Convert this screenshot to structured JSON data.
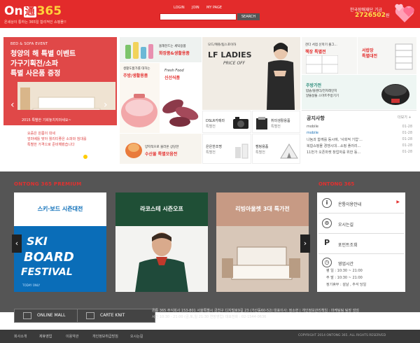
{
  "header": {
    "logo_on": "On",
    "logo_tong": "通",
    "logo_num": "365",
    "slogan": "온세상이 통하는 365일 합리적인 쇼핑몰!!",
    "links": [
      "LOGIN",
      "JOIN",
      "MY PAGE"
    ],
    "search_button": "SEARCH",
    "fund_label": "한국장애재단 기금",
    "fund_count": "2726502",
    "fund_unit": "원"
  },
  "slider": {
    "tag": "BED & SOFA EVENT",
    "title_lines": [
      "청양의 해 특별 이벤트",
      "가구기획전/소파",
      "특별 사은품 증정"
    ],
    "caption": "2015 특별한 기회놓치지마세요~",
    "desc": [
      "요즘은 원룸이 대세",
      "엄마베틀 맞아 퀄리티좋은 소파와 침대를",
      "특별한 가격으로 준비해봤습니다"
    ],
    "prev": "‹",
    "next": "›",
    "dots": 4
  },
  "promo": {
    "top_left": {
      "t1": "올해찬드는 세탁용품",
      "t2": "화장품&생활용품"
    },
    "mid_left": {
      "t1": "생활도품가를 대하는",
      "t2": "주방/생활용품"
    },
    "fresh": {
      "t1": "Fresh Food",
      "t2": "신선식품"
    },
    "lf": {
      "t0": "모드/캐쥬/팀스포이하",
      "t1": "LF LADIES",
      "t2": "PRICE OFF"
    },
    "book": {
      "t1": "찬다 서점 신학기 출그...",
      "t2": "책장 특별전"
    },
    "desk": {
      "t1": "서랍장",
      "t2": "특별대전"
    },
    "kitchen": {
      "t1": "주방가전",
      "t2": "밥솥/블렌더/전자레인지",
      "t3": "알뜰살뜰 스마트주방기기"
    },
    "dslr": {
      "t1": "DSLR카메라",
      "t2": "특별전"
    },
    "hobby": {
      "t1": "취미생활용품",
      "t2": "특별전"
    },
    "heat": {
      "t1": "은은한조명",
      "t2": "특별전"
    },
    "camp": {
      "t1": "캠핑용품",
      "t2": "특별전"
    },
    "soup": {
      "t1": "양지적으로 물러온 상당한",
      "t2": "수산물 특별모음전"
    }
  },
  "notice": {
    "title": "공지사항",
    "more": "더보기 +",
    "items": [
      {
        "text": "mobile",
        "date": "01-28"
      },
      {
        "text": "mobile",
        "date": "01-28"
      },
      {
        "text": "나눔과 함께를 동시에, '사회적 기업'...",
        "date": "01-28"
      },
      {
        "text": "복합쇼핑몰 경쟁시대…쇼핑 플러리...",
        "date": "01-28"
      },
      {
        "text": "11번가 오픈마켓 창업자를 위한 동...",
        "date": "01-28"
      }
    ]
  },
  "premium": {
    "title": "ONTONG 365 PREMIUM",
    "cards": [
      {
        "label": "스키·보드 시즌대전",
        "art1": "SKI",
        "art2": "BOARD",
        "art3": "FESTIVAL",
        "art_small": "TODAY ONLY",
        "color": "#0a6db8"
      },
      {
        "label": "라코스테 시즌오프",
        "color": "#1f4f36"
      },
      {
        "label": "리빙아울렛 3대 특가전",
        "color": "#c79a84"
      }
    ],
    "prev": "‹",
    "next": "›"
  },
  "o365": {
    "title": "ONTONG 365",
    "menu": [
      {
        "icon": "i",
        "label": "온통이용안내"
      },
      {
        "icon": "⊙",
        "label": "오시는길"
      },
      {
        "icon": "P",
        "label": "포인트조회"
      },
      {
        "icon": "◷",
        "label": "영업시간"
      }
    ],
    "hours": [
      {
        "day": "평 일",
        "time": "10:30 ~ 21:00"
      },
      {
        "day": "주 말",
        "time": "10:30 ~ 21:00"
      },
      {
        "day": "정기휴무",
        "time": "설날 , 추석 당일"
      }
    ]
  },
  "footer": {
    "btn1": "ONLINE MALL",
    "btn2": "CARTE KNIT",
    "addr1": "온통 365 주식회사 153-801 서울특별시 금천구 디지털로9길 23 (가산동60-52) 대표이사: 정소현 | 개인정보관리책임 : 마케팅팀 팀장 엄엄",
    "addr2": "시간 10:30 - 21:00 (금,토,일 21:30 연장영업) 대표전화 : 02-1544-0636",
    "links": [
      "회사소개",
      "제휴영업",
      "이용약관",
      "개인정보취급방침",
      "오시는길"
    ],
    "copyright": "COPYRIGHT 2014 ONTONG 365. ALL RIGHTS RESERVED"
  }
}
